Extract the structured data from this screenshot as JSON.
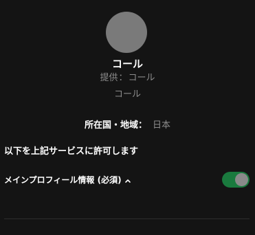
{
  "app": {
    "name": "コール",
    "provider_label": "提供",
    "provider_separator": "：",
    "provider_name": "コール",
    "sub_name": "コール"
  },
  "region": {
    "label": "所在国・地域：",
    "value": "日本"
  },
  "permission": {
    "heading": "以下を上記サービスに許可します"
  },
  "profile": {
    "label": "メインプロフィール情報 (必須)",
    "toggle_state": "on",
    "toggle_color": "#1a7a3e"
  }
}
